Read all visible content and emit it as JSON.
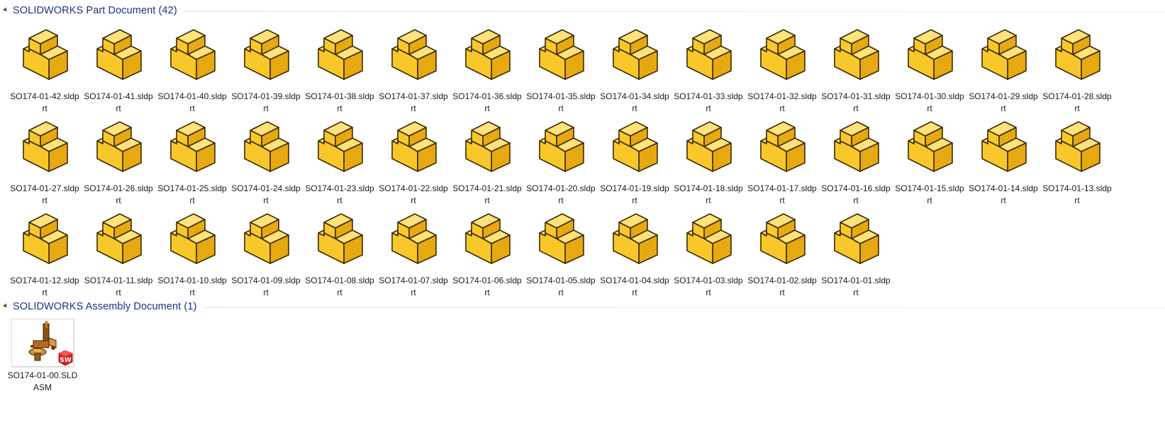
{
  "groups": [
    {
      "title": "SOLIDWORKS Part Document (42)",
      "files": [
        "SO174-01-42.sldprt",
        "SO174-01-41.sldprt",
        "SO174-01-40.sldprt",
        "SO174-01-39.sldprt",
        "SO174-01-38.sldprt",
        "SO174-01-37.sldprt",
        "SO174-01-36.sldprt",
        "SO174-01-35.sldprt",
        "SO174-01-34.sldprt",
        "SO174-01-33.sldprt",
        "SO174-01-32.sldprt",
        "SO174-01-31.sldprt",
        "SO174-01-30.sldprt",
        "SO174-01-29.sldprt",
        "SO174-01-28.sldprt",
        "SO174-01-27.sldprt",
        "SO174-01-26.sldprt",
        "SO174-01-25.sldprt",
        "SO174-01-24.sldprt",
        "SO174-01-23.sldprt",
        "SO174-01-22.sldprt",
        "SO174-01-21.sldprt",
        "SO174-01-20.sldprt",
        "SO174-01-19.sldprt",
        "SO174-01-18.sldprt",
        "SO174-01-17.sldprt",
        "SO174-01-16.sldprt",
        "SO174-01-15.sldprt",
        "SO174-01-14.sldprt",
        "SO174-01-13.sldprt",
        "SO174-01-12.sldprt",
        "SO174-01-11.sldprt",
        "SO174-01-10.sldprt",
        "SO174-01-09.sldprt",
        "SO174-01-08.sldprt",
        "SO174-01-07.sldprt",
        "SO174-01-06.sldprt",
        "SO174-01-05.sldprt",
        "SO174-01-04.sldprt",
        "SO174-01-03.sldprt",
        "SO174-01-02.sldprt",
        "SO174-01-01.sldprt"
      ]
    },
    {
      "title": "SOLIDWORKS Assembly Document (1)",
      "files": [
        "SO174-01-00.SLDASM"
      ]
    }
  ],
  "icons": {
    "part": "solidworks-part-icon",
    "assembly": "solidworks-assembly-thumbnail",
    "badge_text": "SW"
  },
  "colors": {
    "header_text": "#1e3287",
    "part_top": "#ffe27a",
    "part_front": "#f8c82b",
    "part_side": "#e6a912",
    "part_outline": "#3d2a00",
    "sw_badge": "#e0201b"
  }
}
